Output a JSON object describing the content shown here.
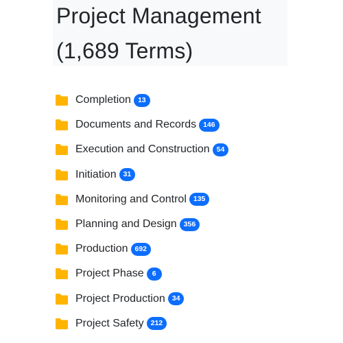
{
  "header": {
    "title": "Project Management",
    "term_count": "(1,689 Terms)"
  },
  "colors": {
    "folder": "#ffb400",
    "badge": "#0d6efd",
    "title_bg": "#f8f9fa"
  },
  "categories": [
    {
      "label": "Completion",
      "count": "13",
      "icon": "folder-icon"
    },
    {
      "label": "Documents and Records",
      "count": "146",
      "icon": "folder-icon"
    },
    {
      "label": "Execution and Construction",
      "count": "54",
      "icon": "folder-icon"
    },
    {
      "label": "Initiation",
      "count": "31",
      "icon": "folder-icon"
    },
    {
      "label": "Monitoring and Control",
      "count": "135",
      "icon": "folder-icon"
    },
    {
      "label": "Planning and Design",
      "count": "356",
      "icon": "folder-icon"
    },
    {
      "label": "Production",
      "count": "692",
      "icon": "folder-icon"
    },
    {
      "label": "Project Phase",
      "count": "6",
      "icon": "folder-icon"
    },
    {
      "label": "Project Production",
      "count": "34",
      "icon": "folder-icon"
    },
    {
      "label": "Project Safety",
      "count": "212",
      "icon": "folder-icon"
    }
  ]
}
